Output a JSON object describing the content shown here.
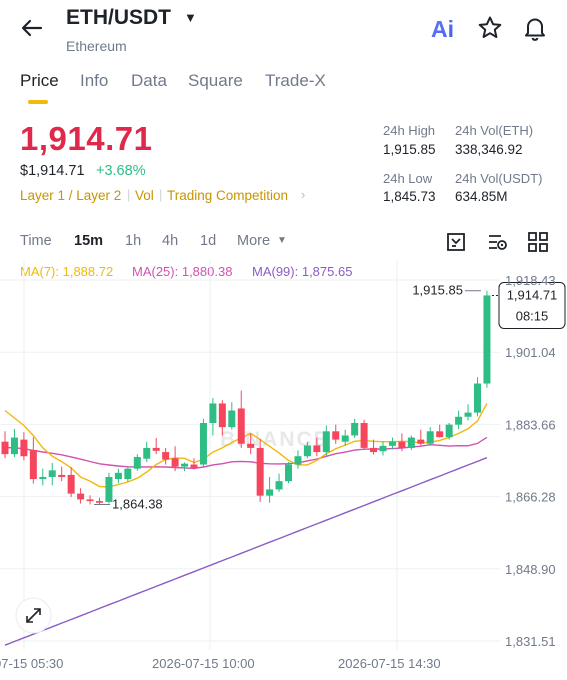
{
  "header": {
    "pair": "ETH/USDT",
    "name": "Ethereum",
    "icons": [
      "back-arrow-icon",
      "caret-down-icon",
      "ai-icon",
      "star-icon",
      "bell-icon"
    ]
  },
  "tabs": [
    {
      "label": "Price",
      "active": true
    },
    {
      "label": "Info",
      "active": false
    },
    {
      "label": "Data",
      "active": false
    },
    {
      "label": "Square",
      "active": false
    },
    {
      "label": "Trade-X",
      "active": false
    }
  ],
  "price": {
    "last": "1,914.71",
    "usd": "$1,914.71",
    "change": "+3.68%"
  },
  "tags": [
    "Layer 1 / Layer 2",
    "Vol",
    "Trading Competition"
  ],
  "stats": {
    "high_label": "24h High",
    "high": "1,915.85",
    "low_label": "24h Low",
    "low": "1,845.73",
    "vol_base_label": "24h Vol(ETH)",
    "vol_base": "338,346.92",
    "vol_quote_label": "24h Vol(USDT)",
    "vol_quote": "634.85M"
  },
  "intervals": [
    {
      "label": "Time",
      "active": false
    },
    {
      "label": "15m",
      "active": true
    },
    {
      "label": "1h",
      "active": false
    },
    {
      "label": "4h",
      "active": false
    },
    {
      "label": "1d",
      "active": false
    },
    {
      "label": "More",
      "active": false
    }
  ],
  "ma_legend": [
    {
      "label": "MA(7): 1,888.72",
      "color": "#f0b90b"
    },
    {
      "label": "MA(25): 1,880.38",
      "color": "#d152b0"
    },
    {
      "label": "MA(99): 1,875.65",
      "color": "#8b5cc8"
    }
  ],
  "watermark": "BINANCE",
  "colors": {
    "up": "#2ebd85",
    "down": "#f6465d",
    "accent": "#f0b90b"
  },
  "chart_data": {
    "type": "candlestick",
    "ylim": [
      1831.51,
      1918.43
    ],
    "yticks": [
      "1,918.43",
      "1,901.04",
      "1,883.66",
      "1,866.28",
      "1,848.90",
      "1,831.51"
    ],
    "xticks": [
      "07-15 05:30",
      "2026-07-15 10:00",
      "2026-07-15 14:30"
    ],
    "high_marker": "1,915.85",
    "low_marker": "1,864.38",
    "last_price_label": "1,914.71",
    "countdown": "08:15",
    "candles": [
      {
        "o": 1879.5,
        "h": 1882.0,
        "l": 1875.5,
        "c": 1876.5
      },
      {
        "o": 1876.5,
        "h": 1882.6,
        "l": 1875.8,
        "c": 1880.5
      },
      {
        "o": 1880.0,
        "h": 1881.8,
        "l": 1875.0,
        "c": 1876.0
      },
      {
        "o": 1877.5,
        "h": 1880.6,
        "l": 1869.4,
        "c": 1870.5
      },
      {
        "o": 1870.5,
        "h": 1873.0,
        "l": 1869.0,
        "c": 1871.0
      },
      {
        "o": 1871.0,
        "h": 1874.4,
        "l": 1869.0,
        "c": 1872.6
      },
      {
        "o": 1871.5,
        "h": 1873.5,
        "l": 1870.0,
        "c": 1871.0
      },
      {
        "o": 1871.5,
        "h": 1873.4,
        "l": 1866.2,
        "c": 1867.0
      },
      {
        "o": 1867.0,
        "h": 1868.3,
        "l": 1864.6,
        "c": 1865.6
      },
      {
        "o": 1865.6,
        "h": 1866.6,
        "l": 1864.4,
        "c": 1865.2
      },
      {
        "o": 1865.2,
        "h": 1866.0,
        "l": 1864.4,
        "c": 1864.8
      },
      {
        "o": 1865.0,
        "h": 1872.0,
        "l": 1864.6,
        "c": 1871.0
      },
      {
        "o": 1870.5,
        "h": 1873.0,
        "l": 1869.5,
        "c": 1872.0
      },
      {
        "o": 1870.5,
        "h": 1873.5,
        "l": 1869.8,
        "c": 1873.0
      },
      {
        "o": 1873.0,
        "h": 1876.5,
        "l": 1872.5,
        "c": 1875.8
      },
      {
        "o": 1875.4,
        "h": 1879.5,
        "l": 1874.6,
        "c": 1878.0
      },
      {
        "o": 1878.0,
        "h": 1880.4,
        "l": 1876.5,
        "c": 1877.3
      },
      {
        "o": 1877.0,
        "h": 1878.0,
        "l": 1874.0,
        "c": 1875.2
      },
      {
        "o": 1875.5,
        "h": 1878.4,
        "l": 1872.4,
        "c": 1873.5
      },
      {
        "o": 1873.5,
        "h": 1874.5,
        "l": 1872.4,
        "c": 1874.2
      },
      {
        "o": 1874.0,
        "h": 1875.5,
        "l": 1872.8,
        "c": 1873.2
      },
      {
        "o": 1874.0,
        "h": 1885.0,
        "l": 1873.5,
        "c": 1884.0
      },
      {
        "o": 1884.0,
        "h": 1890.0,
        "l": 1881.0,
        "c": 1888.7
      },
      {
        "o": 1888.7,
        "h": 1889.5,
        "l": 1881.0,
        "c": 1883.0
      },
      {
        "o": 1883.0,
        "h": 1889.0,
        "l": 1882.4,
        "c": 1887.0
      },
      {
        "o": 1887.5,
        "h": 1891.8,
        "l": 1878.0,
        "c": 1879.0
      },
      {
        "o": 1879.0,
        "h": 1881.5,
        "l": 1876.5,
        "c": 1878.0
      },
      {
        "o": 1878.0,
        "h": 1880.2,
        "l": 1865.0,
        "c": 1866.5
      },
      {
        "o": 1866.5,
        "h": 1871.0,
        "l": 1864.8,
        "c": 1868.0
      },
      {
        "o": 1868.0,
        "h": 1871.8,
        "l": 1867.4,
        "c": 1870.0
      },
      {
        "o": 1870.0,
        "h": 1874.6,
        "l": 1869.5,
        "c": 1874.0
      },
      {
        "o": 1874.0,
        "h": 1877.4,
        "l": 1873.0,
        "c": 1876.0
      },
      {
        "o": 1876.0,
        "h": 1879.5,
        "l": 1875.5,
        "c": 1878.6
      },
      {
        "o": 1878.6,
        "h": 1880.5,
        "l": 1876.0,
        "c": 1877.0
      },
      {
        "o": 1877.0,
        "h": 1883.4,
        "l": 1876.0,
        "c": 1882.0
      },
      {
        "o": 1882.0,
        "h": 1883.6,
        "l": 1879.0,
        "c": 1880.0
      },
      {
        "o": 1879.5,
        "h": 1882.4,
        "l": 1878.5,
        "c": 1881.0
      },
      {
        "o": 1881.0,
        "h": 1885.0,
        "l": 1880.4,
        "c": 1884.0
      },
      {
        "o": 1884.0,
        "h": 1884.8,
        "l": 1877.5,
        "c": 1878.0
      },
      {
        "o": 1878.0,
        "h": 1880.0,
        "l": 1876.4,
        "c": 1877.0
      },
      {
        "o": 1877.2,
        "h": 1879.6,
        "l": 1876.2,
        "c": 1878.5
      },
      {
        "o": 1878.5,
        "h": 1880.5,
        "l": 1877.6,
        "c": 1879.5
      },
      {
        "o": 1879.5,
        "h": 1881.5,
        "l": 1877.2,
        "c": 1878.0
      },
      {
        "o": 1878.0,
        "h": 1881.0,
        "l": 1877.5,
        "c": 1880.5
      },
      {
        "o": 1880.0,
        "h": 1882.4,
        "l": 1878.6,
        "c": 1879.0
      },
      {
        "o": 1879.0,
        "h": 1883.0,
        "l": 1878.5,
        "c": 1882.0
      },
      {
        "o": 1882.0,
        "h": 1883.6,
        "l": 1880.5,
        "c": 1880.6
      },
      {
        "o": 1880.6,
        "h": 1884.0,
        "l": 1880.0,
        "c": 1883.6
      },
      {
        "o": 1883.6,
        "h": 1887.0,
        "l": 1882.5,
        "c": 1885.5
      },
      {
        "o": 1885.5,
        "h": 1888.5,
        "l": 1884.6,
        "c": 1886.5
      },
      {
        "o": 1886.5,
        "h": 1895.0,
        "l": 1885.6,
        "c": 1893.5
      },
      {
        "o": 1893.5,
        "h": 1915.85,
        "l": 1892.5,
        "c": 1914.71
      }
    ],
    "ma7": [
      1887.0,
      1885.2,
      1883.4,
      1881.0,
      1878.0,
      1876.0,
      1874.7,
      1873.2,
      1871.0,
      1870.0,
      1868.7,
      1868.6,
      1869.2,
      1869.8,
      1870.7,
      1872.2,
      1874.0,
      1875.2,
      1875.6,
      1875.5,
      1874.5,
      1875.3,
      1877.0,
      1878.0,
      1879.3,
      1880.4,
      1881.5,
      1880.0,
      1878.4,
      1876.8,
      1875.0,
      1873.9,
      1873.9,
      1875.0,
      1876.6,
      1877.8,
      1878.7,
      1879.6,
      1879.8,
      1879.6,
      1879.5,
      1879.5,
      1879.6,
      1879.5,
      1879.2,
      1879.4,
      1879.8,
      1880.5,
      1881.5,
      1882.6,
      1884.5,
      1888.7
    ]
  }
}
